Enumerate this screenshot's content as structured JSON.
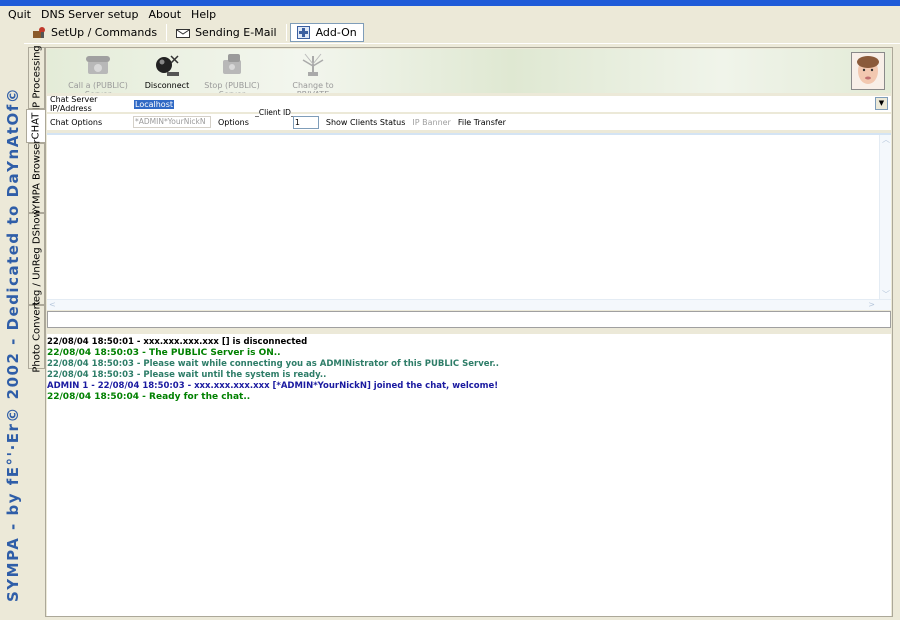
{
  "menu": [
    "Quit",
    "DNS Server setup",
    "About",
    "Help"
  ],
  "toolbar": [
    {
      "label": "SetUp / Commands",
      "icon": "setup-icon"
    },
    {
      "label": "Sending E-Mail",
      "icon": "email-icon"
    },
    {
      "label": "Add-On",
      "icon": "add-on-icon"
    }
  ],
  "sidebar_text": "SYMPA - by fE°'·Er© 2002 - Dedicated to DaYnAtOf©",
  "vertical_tabs": [
    "IP Processing",
    "CHAT",
    "SYMPA Browser",
    "Reg / UnReg DShow",
    "Photo Convert"
  ],
  "banner": {
    "call_server": "Call a (PUBLIC) Server",
    "disconnect": "Disconnect",
    "stop_server": "Stop (PUBLIC) Server",
    "change_private": "Change to PRIVATE"
  },
  "ip_row": {
    "label": "Chat Server IP/Address",
    "value": "Localhost"
  },
  "options_row": {
    "label": "Chat Options",
    "nick_placeholder": "*ADMIN*YourNickN",
    "options": "Options",
    "client_id_caption": "Client ID",
    "client_id_value": "1",
    "show_clients": "Show Clients Status",
    "ip_banner": "IP Banner",
    "file_transfer": "File Transfer"
  },
  "log": [
    {
      "text": "22/08/04 18:50:01 - xxx.xxx.xxx.xxx []  is disconnected",
      "color": "#000000"
    },
    {
      "text": "22/08/04 18:50:03 - The PUBLIC Server is ON..",
      "color": "#008000"
    },
    {
      "text": "22/08/04 18:50:03 - Please wait while connecting you as ADMINistrator of this PUBLIC Server..",
      "color": "#2e7d68"
    },
    {
      "text": "22/08/04 18:50:03 - Please wait until the system is ready..",
      "color": "#2e7d68"
    },
    {
      "text": "ADMIN   1    - 22/08/04 18:50:03 - xxx.xxx.xxx.xxx [*ADMIN*YourNickN]  joined the chat, welcome!",
      "color": "#1a1aa0"
    },
    {
      "text": "22/08/04 18:50:04 - Ready for the chat..",
      "color": "#008000"
    }
  ]
}
